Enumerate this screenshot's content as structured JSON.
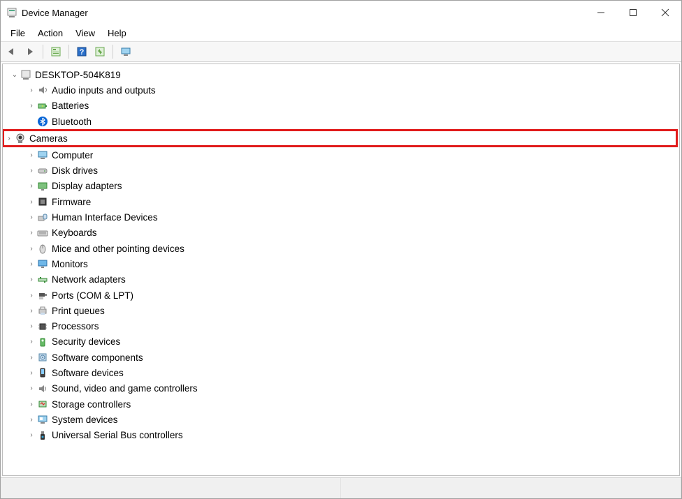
{
  "window": {
    "title": "Device Manager"
  },
  "menu": {
    "file": "File",
    "action": "Action",
    "view": "View",
    "help": "Help"
  },
  "toolbar": {
    "back": "Back",
    "forward": "Forward",
    "properties": "Properties",
    "help": "Help",
    "refresh": "Refresh",
    "monitor": "Scan for hardware changes"
  },
  "tree": {
    "root": {
      "label": "DESKTOP-504K819",
      "expanded": true
    },
    "items": [
      {
        "label": "Audio inputs and outputs",
        "icon": "speaker",
        "highlighted": false
      },
      {
        "label": "Batteries",
        "icon": "battery",
        "highlighted": false
      },
      {
        "label": "Bluetooth",
        "icon": "bluetooth",
        "highlighted": false,
        "noExpander": true
      },
      {
        "label": "Cameras",
        "icon": "camera",
        "highlighted": true
      },
      {
        "label": "Computer",
        "icon": "computer",
        "highlighted": false
      },
      {
        "label": "Disk drives",
        "icon": "disk",
        "highlighted": false
      },
      {
        "label": "Display adapters",
        "icon": "display",
        "highlighted": false
      },
      {
        "label": "Firmware",
        "icon": "chip",
        "highlighted": false
      },
      {
        "label": "Human Interface Devices",
        "icon": "hid",
        "highlighted": false
      },
      {
        "label": "Keyboards",
        "icon": "keyboard",
        "highlighted": false
      },
      {
        "label": "Mice and other pointing devices",
        "icon": "mouse",
        "highlighted": false
      },
      {
        "label": "Monitors",
        "icon": "monitor",
        "highlighted": false
      },
      {
        "label": "Network adapters",
        "icon": "network",
        "highlighted": false
      },
      {
        "label": "Ports (COM & LPT)",
        "icon": "port",
        "highlighted": false
      },
      {
        "label": "Print queues",
        "icon": "printer",
        "highlighted": false
      },
      {
        "label": "Processors",
        "icon": "cpu",
        "highlighted": false
      },
      {
        "label": "Security devices",
        "icon": "security",
        "highlighted": false
      },
      {
        "label": "Software components",
        "icon": "swcomp",
        "highlighted": false
      },
      {
        "label": "Software devices",
        "icon": "swdev",
        "highlighted": false
      },
      {
        "label": "Sound, video and game controllers",
        "icon": "sound",
        "highlighted": false
      },
      {
        "label": "Storage controllers",
        "icon": "storage",
        "highlighted": false
      },
      {
        "label": "System devices",
        "icon": "system",
        "highlighted": false
      },
      {
        "label": "Universal Serial Bus controllers",
        "icon": "usb",
        "highlighted": false
      }
    ]
  }
}
